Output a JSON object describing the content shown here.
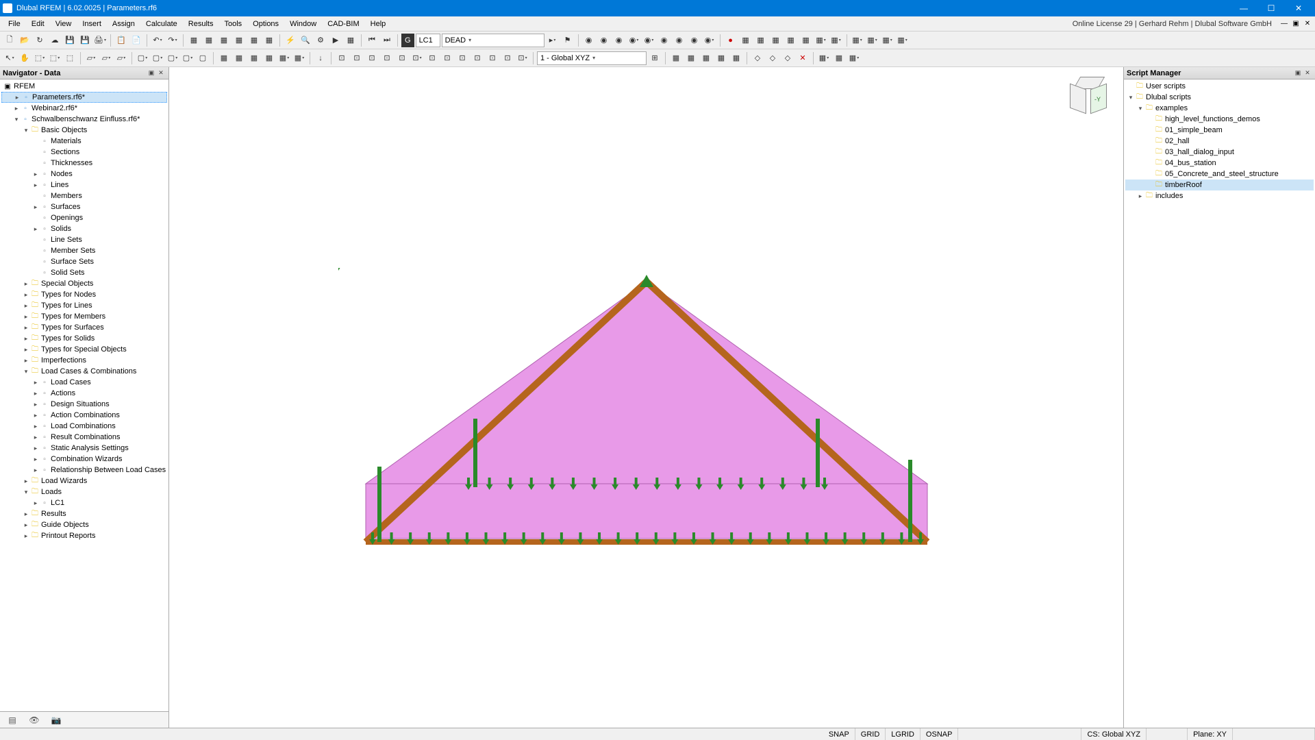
{
  "title": "Dlubal RFEM | 6.02.0025 | Parameters.rf6",
  "license_info": "Online License 29 | Gerhard Rehm | Dlubal Software GmbH",
  "menu": [
    "File",
    "Edit",
    "View",
    "Insert",
    "Assign",
    "Calculate",
    "Results",
    "Tools",
    "Options",
    "Window",
    "CAD-BIM",
    "Help"
  ],
  "toolbar1": {
    "load_case_badge": "G",
    "load_case_code": "LC1",
    "load_case_name": "DEAD"
  },
  "toolbar2": {
    "coord_system": "1 - Global XYZ"
  },
  "navigator": {
    "title": "Navigator - Data",
    "root": "RFEM",
    "files": [
      {
        "label": "Parameters.rf6*",
        "selected": true
      },
      {
        "label": "Webinar2.rf6*"
      },
      {
        "label": "Schwalbenschwanz Einfluss.rf6*",
        "expanded": true
      }
    ],
    "basic_objects": {
      "label": "Basic Objects",
      "children": [
        {
          "label": "Materials"
        },
        {
          "label": "Sections"
        },
        {
          "label": "Thicknesses"
        },
        {
          "label": "Nodes",
          "exp": true
        },
        {
          "label": "Lines",
          "exp": true
        },
        {
          "label": "Members"
        },
        {
          "label": "Surfaces",
          "exp": true
        },
        {
          "label": "Openings"
        },
        {
          "label": "Solids",
          "exp": true
        },
        {
          "label": "Line Sets"
        },
        {
          "label": "Member Sets"
        },
        {
          "label": "Surface Sets"
        },
        {
          "label": "Solid Sets"
        }
      ]
    },
    "groups": [
      {
        "label": "Special Objects"
      },
      {
        "label": "Types for Nodes"
      },
      {
        "label": "Types for Lines"
      },
      {
        "label": "Types for Members"
      },
      {
        "label": "Types for Surfaces"
      },
      {
        "label": "Types for Solids"
      },
      {
        "label": "Types for Special Objects"
      },
      {
        "label": "Imperfections"
      }
    ],
    "loadcomb": {
      "label": "Load Cases & Combinations",
      "children": [
        {
          "label": "Load Cases"
        },
        {
          "label": "Actions"
        },
        {
          "label": "Design Situations"
        },
        {
          "label": "Action Combinations"
        },
        {
          "label": "Load Combinations"
        },
        {
          "label": "Result Combinations"
        },
        {
          "label": "Static Analysis Settings"
        },
        {
          "label": "Combination Wizards"
        },
        {
          "label": "Relationship Between Load Cases"
        }
      ]
    },
    "load_wizards": "Load Wizards",
    "loads": {
      "label": "Loads",
      "children": [
        {
          "label": "LC1"
        }
      ]
    },
    "tail": [
      {
        "label": "Results"
      },
      {
        "label": "Guide Objects"
      },
      {
        "label": "Printout Reports"
      }
    ]
  },
  "script_manager": {
    "title": "Script Manager",
    "nodes": {
      "user_scripts": "User scripts",
      "dlubal_scripts": "Dlubal scripts",
      "examples": "examples",
      "examples_children": [
        "high_level_functions_demos",
        "01_simple_beam",
        "02_hall",
        "03_hall_dialog_input",
        "04_bus_station",
        "05_Concrete_and_steel_structure",
        "timberRoof"
      ],
      "includes": "includes"
    }
  },
  "view_cube_label": "-Y",
  "status": {
    "snap": "SNAP",
    "grid": "GRID",
    "lgrid": "LGRID",
    "osnap": "OSNAP",
    "cs": "CS: Global XYZ",
    "plane": "Plane: XY"
  }
}
